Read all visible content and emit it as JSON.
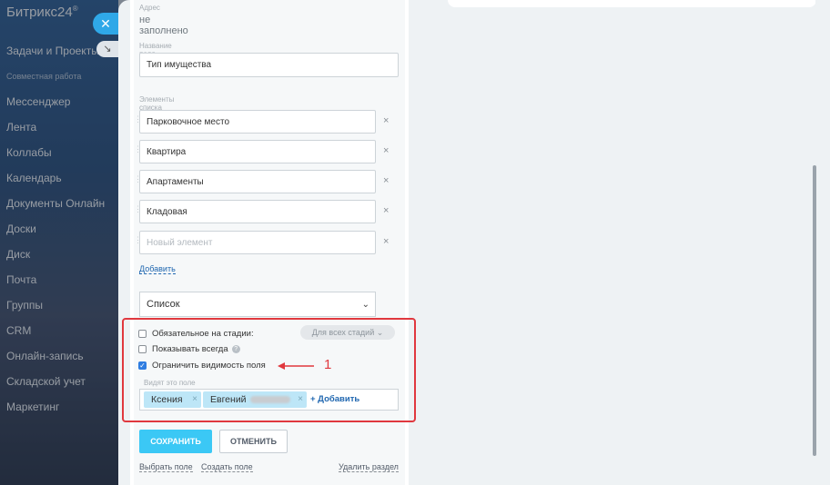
{
  "app": {
    "logo": "Битрикс24",
    "logo_mark": "®"
  },
  "nav": [
    {
      "label": "Задачи и Проекты"
    },
    {
      "label": "Совместная работа"
    },
    {
      "label": "Мессенджер"
    },
    {
      "label": "Лента"
    },
    {
      "label": "Коллабы"
    },
    {
      "label": "Календарь"
    },
    {
      "label": "Документы Онлайн"
    },
    {
      "label": "Доски"
    },
    {
      "label": "Диск"
    },
    {
      "label": "Почта"
    },
    {
      "label": "Группы"
    },
    {
      "label": "CRM"
    },
    {
      "label": "Онлайн-запись"
    },
    {
      "label": "Складской учет"
    },
    {
      "label": "Маркетинг"
    }
  ],
  "form": {
    "address_label": "Адрес",
    "address_value": "не заполнено",
    "field_name_label": "Название поля",
    "field_name_value": "Тип имущества",
    "list_items_label": "Элементы списка",
    "list_items": [
      {
        "value": "Парковочное место"
      },
      {
        "value": "Квартира"
      },
      {
        "value": "Апартаменты"
      },
      {
        "value": "Кладовая"
      }
    ],
    "new_item_placeholder": "Новый элемент",
    "add_link": "Добавить",
    "type_select": "Список",
    "required_label": "Обязательное на стадии:",
    "stages_pill": "Для всех стадий",
    "show_always_label": "Показывать всегда",
    "restrict_label": "Ограничить видимость поля",
    "visible_to_label": "Видят это поле",
    "users": [
      {
        "name": "Ксения"
      },
      {
        "name": "Евгений"
      }
    ],
    "add_user": "+ Добавить",
    "annotation": "1"
  },
  "buttons": {
    "save": "СОХРАНИТЬ",
    "cancel": "ОТМЕНИТЬ"
  },
  "footer": {
    "select_field": "Выбрать поле",
    "create_field": "Создать поле",
    "delete_section": "Удалить раздел"
  },
  "colors": {
    "accent": "#3bc8f5",
    "link": "#2067b0",
    "highlight": "#e0383e",
    "chip": "#bde6f7"
  }
}
